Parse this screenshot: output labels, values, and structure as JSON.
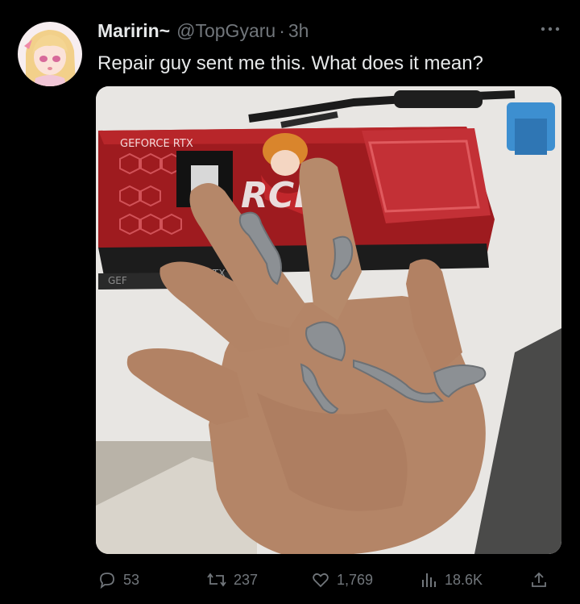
{
  "author": {
    "display_name": "Maririn~",
    "handle": "@TopGyaru",
    "separator": "·",
    "time": "3h"
  },
  "tweet": {
    "text": "Repair guy sent me this. What does it mean?"
  },
  "media": {
    "card_text_1": "GEFORCE RTX",
    "card_text_2": "GEF",
    "card_text_3": "TX"
  },
  "actions": {
    "replies": "53",
    "retweets": "237",
    "likes": "1,769",
    "views": "18.6K"
  },
  "colors": {
    "background": "#000000",
    "primary_text": "#e7e9ea",
    "secondary_text": "#71767b"
  },
  "icons": {
    "more": "more-dots-icon",
    "reply": "reply-bubble-icon",
    "retweet": "retweet-arrows-icon",
    "like": "heart-icon",
    "views": "bar-chart-icon",
    "share": "share-upload-icon"
  }
}
